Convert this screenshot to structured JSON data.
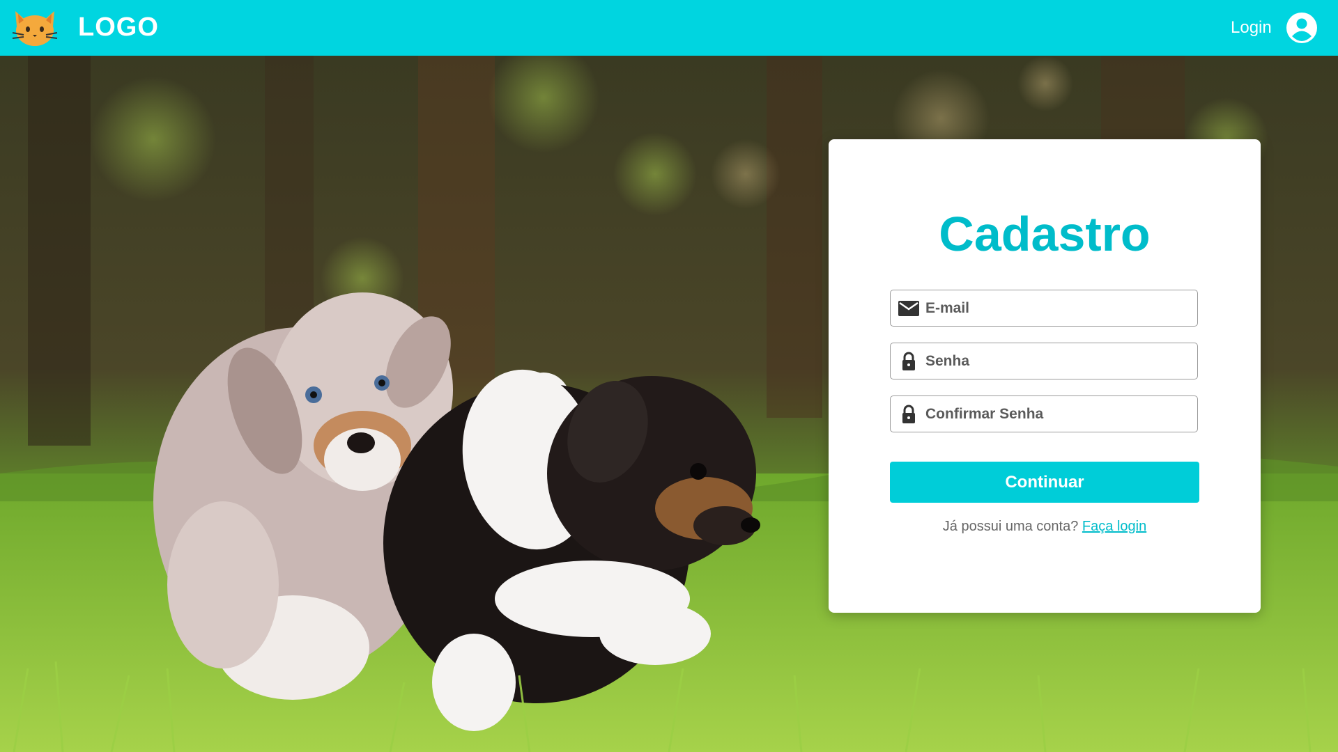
{
  "header": {
    "logo_text": "LOGO",
    "logo_icon": "cat-face-icon",
    "login_label": "Login",
    "account_icon": "account-circle-icon",
    "bar_color": "#00d5e0"
  },
  "background": {
    "icon": "puppies-photo"
  },
  "form": {
    "title": "Cadastro",
    "email": {
      "placeholder": "E-mail",
      "value": "",
      "icon": "mail-icon"
    },
    "password": {
      "placeholder": "Senha",
      "value": "",
      "icon": "lock-icon"
    },
    "confirm_password": {
      "placeholder": "Confirmar Senha",
      "value": "",
      "icon": "lock-icon"
    },
    "submit_label": "Continuar",
    "footer_prefix": "Já possui uma conta?",
    "footer_link": "Faça login",
    "accent_color": "#00bcca"
  }
}
